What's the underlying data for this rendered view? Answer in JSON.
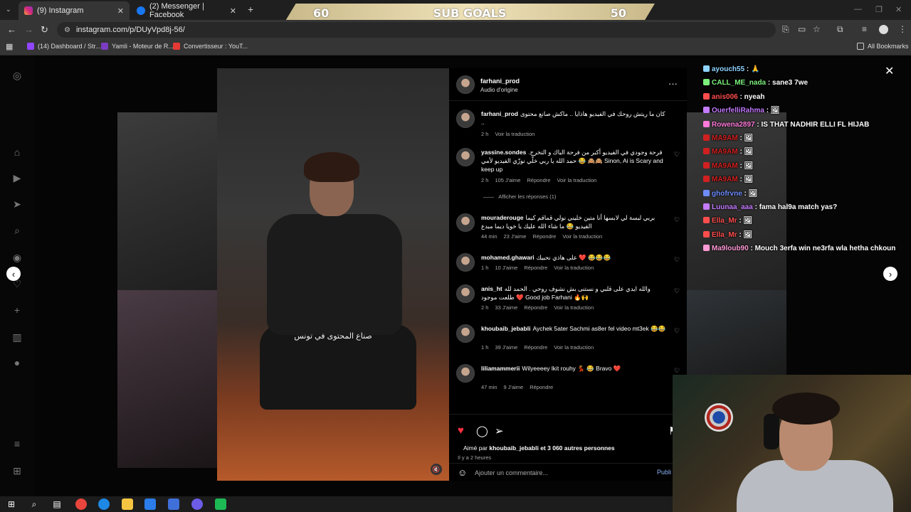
{
  "browser": {
    "tabs": [
      {
        "label": "(9) Instagram",
        "active": true
      },
      {
        "label": "(2) Messenger | Facebook",
        "active": false
      }
    ],
    "url": "instagram.com/p/DUyVpd8j-56/",
    "bookmarks": [
      {
        "label": "(14) Dashboard / Str..."
      },
      {
        "label": "Yamli - Moteur de R..."
      },
      {
        "label": "Convertisseur : YouT..."
      }
    ],
    "all_bookmarks": "All Bookmarks"
  },
  "overlay": {
    "sub_goal_left": "60",
    "sub_goal_title": "SUB GOALS",
    "sub_goal_right": "50"
  },
  "post": {
    "author": "farhani_prod",
    "audio": "Audio d'origine",
    "video_caption": "صناع المحتوى في تونس",
    "caption": {
      "user": "farhani_prod",
      "text": "كان ما ريتش روحك في الفيديو هاذايا .. ماكش صانع محتوى ..",
      "time": "2 h",
      "translate": "Voir la traduction"
    },
    "comments": [
      {
        "user": "yassine.sondes",
        "text": "فرحة وجودي في الفيديو أكبر من فرحة الباك و التخرج. حمد الله يا ربي خلّي نوزّي الفيديو لأمي 😂 🙈🙈 Sinon, Ai is Scary and keep up",
        "time": "2 h",
        "likes": "105 J'aime",
        "reply": "Répondre",
        "translate": "Voir la traduction"
      },
      {
        "user": "mouraderouge",
        "text": "بربي لبسة لي لابسها أنا متين خليني نولي قماقم كيما الفيديو 😂 ما شاء الله عليك يا خويا ديما مبدع",
        "time": "44 min",
        "likes": "23 J'aime",
        "reply": "Répondre",
        "translate": "Voir la traduction"
      },
      {
        "user": "mohamed.ghawari",
        "text": "على هاذي نحبيك ❤️ 😂😂😂",
        "time": "1 h",
        "likes": "10 J'aime",
        "reply": "Répondre",
        "translate": "Voir la traduction"
      },
      {
        "user": "anis_ht",
        "text": "والله ايدي على قلبي و نستنى بش نشوف روحي . الحمد لله طلعت موجود ❤️ Good job Farhani 🔥🙌",
        "time": "2 h",
        "likes": "33 J'aime",
        "reply": "Répondre",
        "translate": "Voir la traduction"
      },
      {
        "user": "khoubaib_jebabli",
        "text": "Aychek 5ater Sachmi as8er fel video mt3ek 😂😂",
        "time": "1 h",
        "likes": "39 J'aime",
        "reply": "Répondre",
        "translate": "Voir la traduction"
      },
      {
        "user": "liliamammerii",
        "text": "Wilyeeeey lkit rouhy 💃 😂 Bravo ❤️",
        "time": "47 min",
        "likes": "9 J'aime",
        "reply": "Répondre",
        "translate": ""
      }
    ],
    "show_replies": "Afficher les réponses (1)",
    "liked_prefix": "Aimé par",
    "liked_user": "khoubaib_jebabli",
    "liked_suffix": "et 3 060 autres personnes",
    "posted_ago": "Il y a 2 heures",
    "add_comment_placeholder": "Ajouter un commentaire...",
    "publish": "Publi"
  },
  "chat": [
    {
      "user": "ayouch55",
      "msg": " : 🙏",
      "color": "#8fd3ff"
    },
    {
      "user": "CALL_ME_nada",
      "msg": " : sane3 7we",
      "color": "#7cf07c"
    },
    {
      "user": "anis006",
      "msg": " : nyeah",
      "color": "#ff4d4d"
    },
    {
      "user": "OuerfelliRahma",
      "msg": " : 🖼",
      "color": "#c47bff"
    },
    {
      "user": "Rowena2897",
      "msg": " : IS THAT NADHIR ELLI FL HIJAB",
      "color": "#ff7ad9"
    },
    {
      "user": "MA9AM",
      "msg": " : 🖼",
      "color": "#d02020"
    },
    {
      "user": "MA9AM",
      "msg": " : 🖼",
      "color": "#d02020"
    },
    {
      "user": "MA9AM",
      "msg": " : 🖼",
      "color": "#d02020"
    },
    {
      "user": "MA9AM",
      "msg": " : 🖼",
      "color": "#d02020"
    },
    {
      "user": "ghofrvne",
      "msg": " : 🖼",
      "color": "#6d8cff"
    },
    {
      "user": "Luunaa_aaa",
      "msg": " : fama hal9a match yas?",
      "color": "#c47bff"
    },
    {
      "user": "Ella_Mr",
      "msg": " : 🖼",
      "color": "#ff4d4d"
    },
    {
      "user": "Ella_Mr",
      "msg": " : 🖼",
      "color": "#ff4d4d"
    },
    {
      "user": "Ma9loub90",
      "msg": " : Mouch 3erfa win ne3rfa wla hetha chkoun",
      "color": "#ff9ad5"
    }
  ]
}
